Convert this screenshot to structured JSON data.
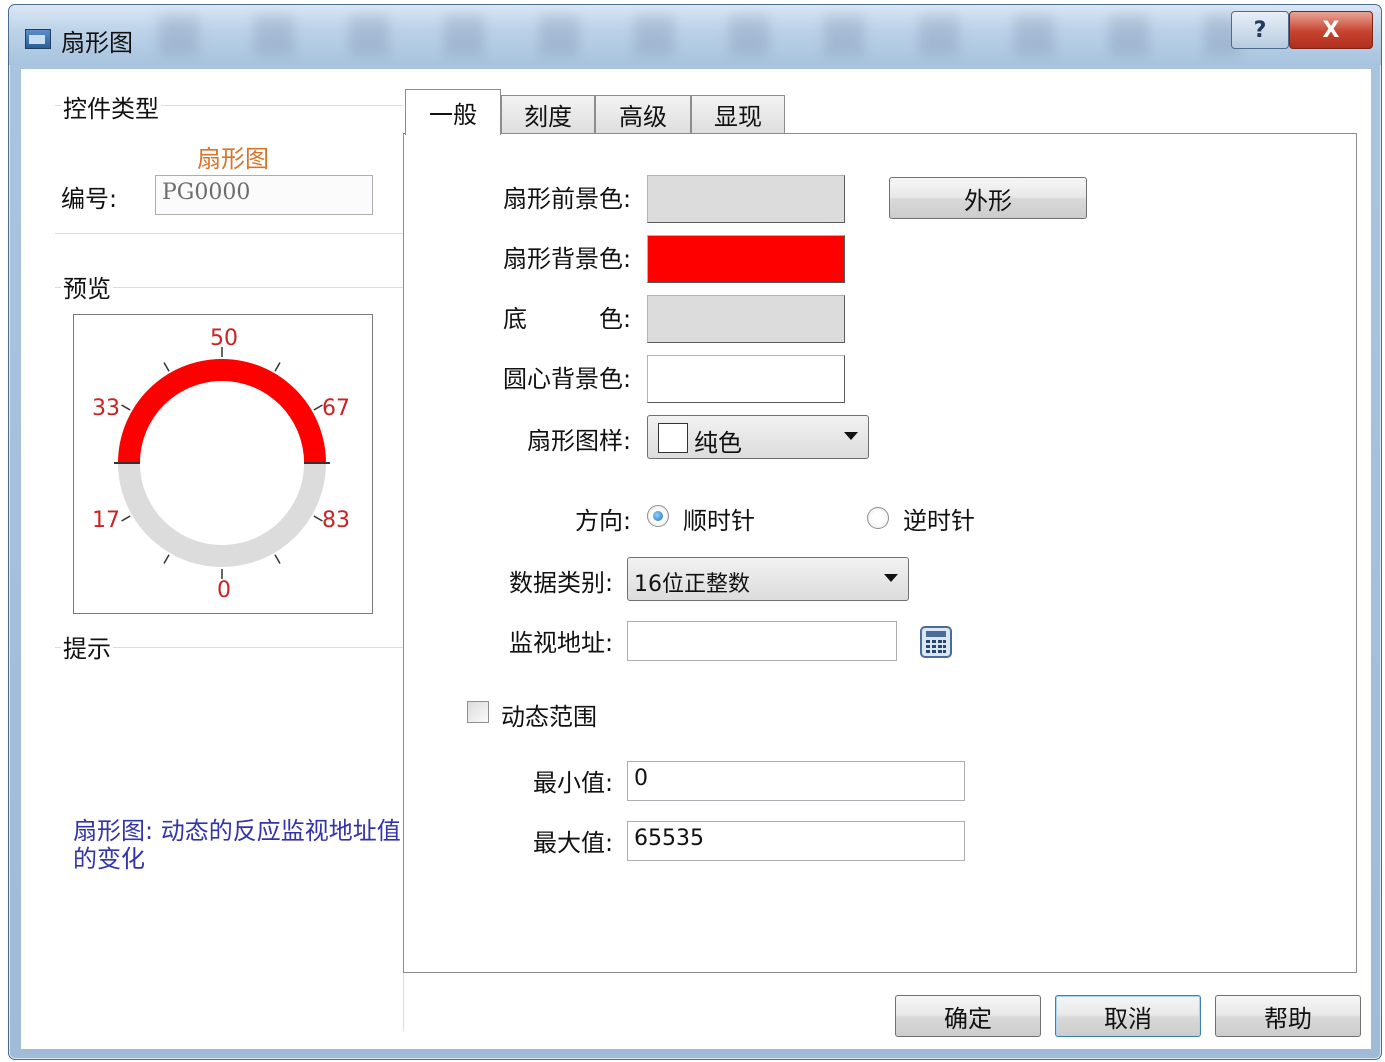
{
  "window": {
    "title": "扇形图",
    "help_glyph": "?",
    "close_glyph": "X"
  },
  "left": {
    "control_type_group": "控件类型",
    "control_type_value": "扇形图",
    "id_label": "编号:",
    "id_value": "PG0000",
    "preview_group": "预览",
    "hint_group": "提示",
    "hint_text": "扇形图: 动态的反应监视地址值的变化"
  },
  "preview_gauge": {
    "scale_labels": [
      "0",
      "17",
      "33",
      "50",
      "67",
      "83"
    ],
    "fill_color": "#ff0000",
    "base_color": "#dcdcdc",
    "label_color": "#cc2222"
  },
  "tabs": [
    {
      "label": "一般",
      "active": true
    },
    {
      "label": "刻度",
      "active": false
    },
    {
      "label": "高级",
      "active": false
    },
    {
      "label": "显现",
      "active": false
    }
  ],
  "general": {
    "fg_color_label": "扇形前景色:",
    "fg_color": "#dcdcdc",
    "bg_color_label": "扇形背景色:",
    "bg_color": "#ff0000",
    "base_color_label_a": "底",
    "base_color_label_b": "色:",
    "base_color": "#dcdcdc",
    "center_bg_label": "圆心背景色:",
    "center_bg_color": "#ffffff",
    "shape_button": "外形",
    "pattern_label": "扇形图样:",
    "pattern_value": "纯色",
    "direction_label": "方向:",
    "direction_cw": "顺时针",
    "direction_ccw": "逆时针",
    "data_type_label": "数据类别:",
    "data_type_value": "16位正整数",
    "monitor_addr_label": "监视地址:",
    "monitor_addr_value": "",
    "dynamic_range_label": "动态范围",
    "min_label": "最小值:",
    "min_value": "0",
    "max_label": "最大值:",
    "max_value": "65535"
  },
  "footer": {
    "ok": "确定",
    "cancel": "取消",
    "help": "帮助"
  }
}
